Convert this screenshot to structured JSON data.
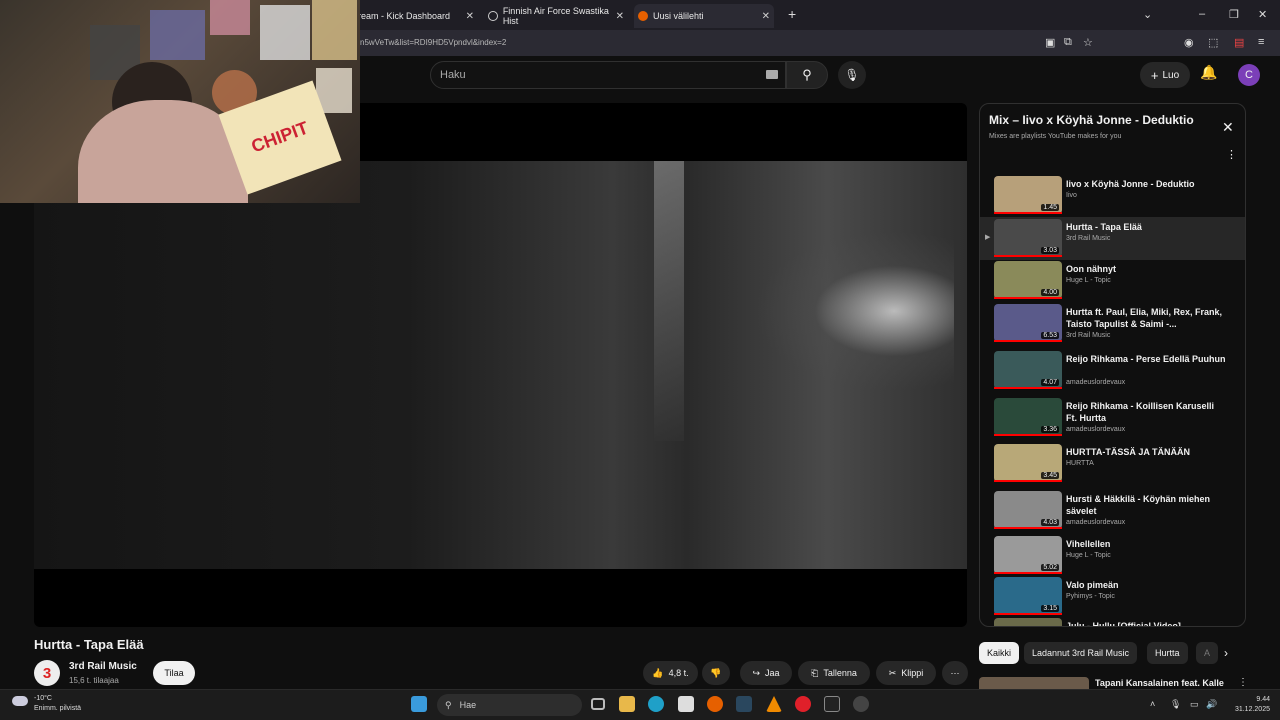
{
  "browser": {
    "tabs": [
      {
        "label": "ream - Kick Dashboard",
        "active": false
      },
      {
        "label": "Finnish Air Force Swastika Hist",
        "active": false
      },
      {
        "label": "Uusi välilehti",
        "active": true
      }
    ],
    "url": "n5wVeTw&list=RDI9HD5Vpndvl&index=2"
  },
  "youtube": {
    "search_placeholder": "Haku",
    "create_label": "Luo",
    "avatar_letter": "C"
  },
  "webcam": {
    "sign_text": "CHIPIT"
  },
  "video": {
    "title": "Hurtta - Tapa Elää",
    "channel": "3rd Rail Music",
    "channel_logo": "3",
    "subscribers": "15,6 t. tilaajaa",
    "subscribe_label": "Tilaa",
    "likes": "4,8 t.",
    "share_label": "Jaa",
    "save_label": "Tallenna",
    "clip_label": "Klippi"
  },
  "playlist": {
    "title": "Mix – Iivo x Köyhä Jonne - Deduktio",
    "subtitle": "Mixes are playlists YouTube makes for you",
    "items": [
      {
        "title": "Iivo x Köyhä Jonne - Deduktio",
        "channel": "Iivo",
        "duration": "1.45",
        "color": "#b7a07a"
      },
      {
        "title": "Hurtta - Tapa Elää",
        "channel": "3rd Rail Music",
        "duration": "3.03",
        "color": "#4a4a4a",
        "current": true
      },
      {
        "title": "Oon nähnyt",
        "channel": "Huge L - Topic",
        "duration": "4.00",
        "color": "#8a8a5a"
      },
      {
        "title": "Hurtta ft. Paul, Elia, Miki, Rex, Frank, Taisto Tapulist & Saimi -...",
        "channel": "3rd Rail Music",
        "duration": "6.53",
        "color": "#5a5a8a"
      },
      {
        "title": "Reijo Rihkama - Perse Edellä Puuhun",
        "channel": "amadeuslordevaux",
        "duration": "4.07",
        "color": "#3a5a5a"
      },
      {
        "title": "Reijo Rihkama - Koillisen Karuselli Ft. Hurtta",
        "channel": "amadeuslordevaux",
        "duration": "3.36",
        "color": "#2a4a3a"
      },
      {
        "title": "HURTTA-TÄSSÄ JA TÄNÄÄN",
        "channel": "HURTTA",
        "duration": "3.45",
        "color": "#b8a878"
      },
      {
        "title": "Hursti & Häkkilä - Köyhän miehen sävelet",
        "channel": "amadeuslordevaux",
        "duration": "4.03",
        "color": "#8a8a8a"
      },
      {
        "title": "Vihellellen",
        "channel": "Huge L - Topic",
        "duration": "5.02",
        "color": "#9a9a9a"
      },
      {
        "title": "Valo pimeän",
        "channel": "Pyhimys - Topic",
        "duration": "3.15",
        "color": "#2a6a8a"
      },
      {
        "title": "Julu - Hullu [Official Video]",
        "channel": "",
        "duration": "",
        "color": "#6a6a4a"
      }
    ]
  },
  "chips": [
    "Kaikki",
    "Ladannut 3rd Rail Music",
    "Hurtta",
    "A"
  ],
  "next_up": {
    "title": "Tapani Kansalainen feat. Kalle"
  },
  "taskbar": {
    "weather_temp": "-10°C",
    "weather_desc": "Enimm. pilvistä",
    "search_label": "Hae",
    "time": "9.44",
    "date": "31.12.2025"
  }
}
